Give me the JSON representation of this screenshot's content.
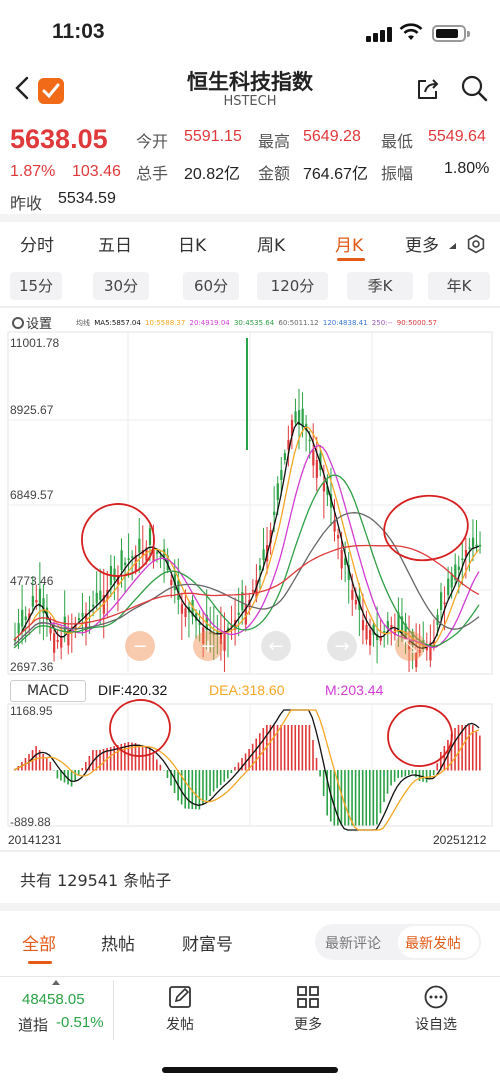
{
  "status_bar": {
    "time": "11:03"
  },
  "header": {
    "title": "恒生科技指数",
    "subtitle": "HSTECH"
  },
  "quote": {
    "price": "5638.05",
    "change_pct": "1.87%",
    "change": "103.46",
    "prev_close_label": "昨收",
    "prev_close": "5534.59",
    "open_label": "今开",
    "open": "5591.15",
    "high_label": "最高",
    "high": "5649.28",
    "low_label": "最低",
    "low": "5549.64",
    "volume_label": "总手",
    "volume": "20.82亿",
    "amount_label": "金额",
    "amount": "764.67亿",
    "amplitude_label": "振幅",
    "amplitude": "1.80%"
  },
  "period_tabs": [
    "分时",
    "五日",
    "日K",
    "周K",
    "月K",
    "更多"
  ],
  "active_period": "月K",
  "sub_periods": [
    "15分",
    "30分",
    "60分",
    "120分",
    "季K",
    "年K"
  ],
  "chart": {
    "settings_label": "设置",
    "ma_legend": [
      {
        "text": "均线",
        "color": "#555555"
      },
      {
        "text": "MA5:5857.04",
        "color": "#111111"
      },
      {
        "text": "10:5588.37",
        "color": "#f5a623"
      },
      {
        "text": "20:4919.04",
        "color": "#d23cd2"
      },
      {
        "text": "30:4535.64",
        "color": "#2e9e45"
      },
      {
        "text": "60:5011.12",
        "color": "#666666"
      },
      {
        "text": "120:4838.41",
        "color": "#3c78d8"
      },
      {
        "text": "250:--",
        "color": "#9b59b6"
      },
      {
        "text": "90:5000.57",
        "color": "#e0393b"
      }
    ],
    "y_ticks": [
      "11001.78",
      "8925.67",
      "6849.57",
      "4773.46",
      "2697.36"
    ],
    "macd_label": "MACD",
    "dif": "DIF:420.32",
    "dea": "DEA:318.60",
    "m": "M:203.44",
    "macd_ticks": [
      "1168.95",
      "-889.88"
    ],
    "start_date": "20141231",
    "end_date": "20251212",
    "colors": {
      "up": "#e0393b",
      "down": "#2ba245"
    }
  },
  "posts": {
    "count_text": "共有 129541 条帖子"
  },
  "comment_tabs": [
    "全部",
    "热帖",
    "财富号"
  ],
  "sort_options": [
    "最新评论",
    "最新发帖"
  ],
  "bottom_bar": {
    "index_value": "48458.05",
    "index_label": "道指",
    "index_change": "-0.51%",
    "items": [
      {
        "icon": "edit-icon",
        "label": "发帖"
      },
      {
        "icon": "grid-icon",
        "label": "更多"
      },
      {
        "icon": "more-circle-icon",
        "label": "设自选"
      }
    ]
  }
}
